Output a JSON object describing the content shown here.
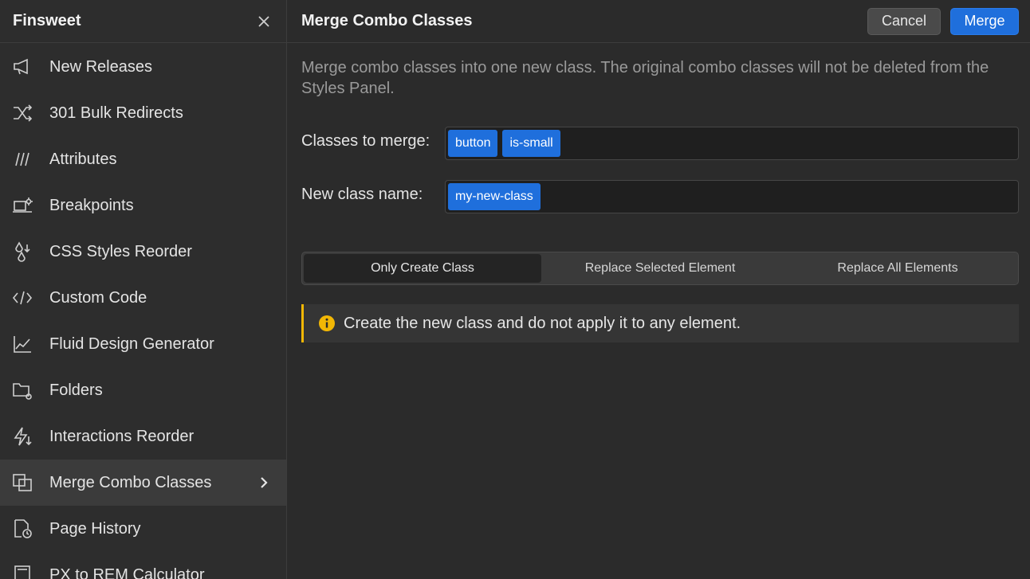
{
  "sidebar": {
    "title": "Finsweet",
    "close_icon": "close-icon",
    "items": [
      {
        "label": "New Releases",
        "icon": "megaphone-icon"
      },
      {
        "label": "301 Bulk Redirects",
        "icon": "shuffle-icon"
      },
      {
        "label": "Attributes",
        "icon": "slashes-icon"
      },
      {
        "label": "Breakpoints",
        "icon": "breakpoints-icon"
      },
      {
        "label": "CSS Styles Reorder",
        "icon": "drops-icon"
      },
      {
        "label": "Custom Code",
        "icon": "code-icon"
      },
      {
        "label": "Fluid Design Generator",
        "icon": "chart-icon"
      },
      {
        "label": "Folders",
        "icon": "folder-gear-icon"
      },
      {
        "label": "Interactions Reorder",
        "icon": "bolt-icon"
      },
      {
        "label": "Merge Combo Classes",
        "icon": "merge-icon",
        "active": true
      },
      {
        "label": "Page History",
        "icon": "page-history-icon"
      },
      {
        "label": "PX to REM Calculator",
        "icon": "calculator-icon"
      }
    ]
  },
  "main": {
    "title": "Merge Combo Classes",
    "cancel_label": "Cancel",
    "merge_label": "Merge",
    "description": "Merge combo classes into one new class. The original combo classes will not be deleted from the Styles Panel.",
    "classes_label": "Classes to merge:",
    "classes": [
      "button",
      "is-small"
    ],
    "new_class_label": "New class name:",
    "new_class": "my-new-class",
    "options": [
      "Only Create Class",
      "Replace Selected Element",
      "Replace All Elements"
    ],
    "selected_option": "Only Create Class",
    "notice_icon": "info-icon",
    "notice": "Create the new class and do not apply it to any element.",
    "colors": {
      "accent": "#1f6fdc",
      "warning": "#f2b705"
    }
  }
}
